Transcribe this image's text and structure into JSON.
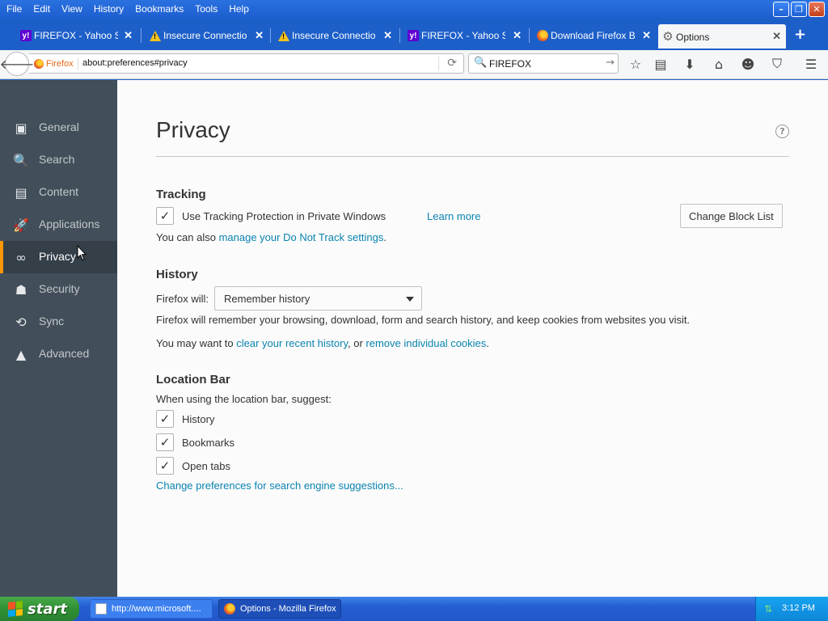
{
  "menubar": {
    "items": [
      "File",
      "Edit",
      "View",
      "History",
      "Bookmarks",
      "Tools",
      "Help"
    ],
    "controls": {
      "minimize": "–",
      "restore": "❐",
      "close": "✕"
    }
  },
  "tabs": [
    {
      "label": "FIREFOX - Yahoo S...",
      "icon": "yahoo-icon",
      "close": "✕"
    },
    {
      "label": "Insecure Connection",
      "icon": "warning-icon",
      "close": "✕"
    },
    {
      "label": "Insecure Connection",
      "icon": "warning-icon",
      "close": "✕"
    },
    {
      "label": "FIREFOX - Yahoo S...",
      "icon": "yahoo-icon",
      "close": "✕"
    },
    {
      "label": "Download Firefox Br...",
      "icon": "firefox-icon",
      "close": "✕"
    },
    {
      "label": "Options",
      "icon": "gear-icon",
      "close": "✕",
      "active": true
    }
  ],
  "newtab": "+",
  "navbar": {
    "identity": "Firefox",
    "url": "about:preferences#privacy",
    "search_value": "FIREFOX"
  },
  "sidebar": {
    "items": [
      {
        "label": "General",
        "icon": "general-icon"
      },
      {
        "label": "Search",
        "icon": "search-icon"
      },
      {
        "label": "Content",
        "icon": "content-icon"
      },
      {
        "label": "Applications",
        "icon": "applications-icon"
      },
      {
        "label": "Privacy",
        "icon": "privacy-mask-icon",
        "selected": true
      },
      {
        "label": "Security",
        "icon": "security-icon"
      },
      {
        "label": "Sync",
        "icon": "sync-icon"
      },
      {
        "label": "Advanced",
        "icon": "advanced-icon"
      }
    ]
  },
  "privacy": {
    "title": "Privacy",
    "tracking": {
      "heading": "Tracking",
      "checkbox_label": "Use Tracking Protection in Private Windows",
      "learn_more": "Learn more",
      "change_block_list": "Change Block List",
      "dnt_prefix": "You can also ",
      "dnt_link": "manage your Do Not Track settings",
      "dnt_suffix": "."
    },
    "history": {
      "heading": "History",
      "will_label": "Firefox will:",
      "select_value": "Remember history",
      "description": "Firefox will remember your browsing, download, form and search history, and keep cookies from websites you visit.",
      "may_prefix": "You may want to ",
      "clear_link": "clear your recent history",
      "or_text": ", or ",
      "remove_link": "remove individual cookies",
      "period": "."
    },
    "location_bar": {
      "heading": "Location Bar",
      "suggest_label": "When using the location bar, suggest:",
      "options": [
        "History",
        "Bookmarks",
        "Open tabs"
      ],
      "change_prefs_link": "Change preferences for search engine suggestions..."
    }
  },
  "taskbar": {
    "start": "start",
    "tasks": [
      {
        "label": "http://www.microsoft....",
        "active": false
      },
      {
        "label": "Options - Mozilla Firefox",
        "active": true
      }
    ],
    "clock": "3:12 PM"
  },
  "colors": {
    "accent_selected": "#ff9500",
    "link": "#0a84b0",
    "sidebar_bg": "#424f5a"
  }
}
